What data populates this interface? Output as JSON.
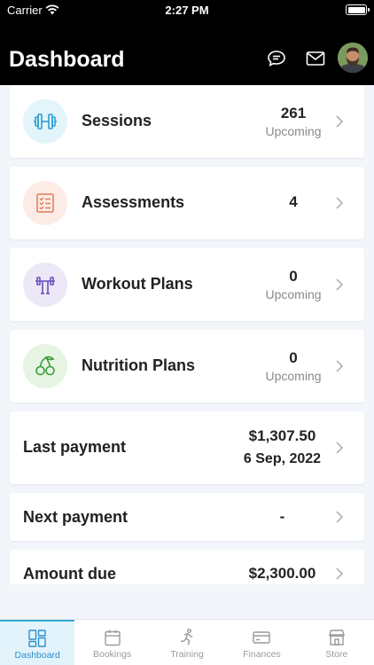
{
  "status_bar": {
    "carrier": "Carrier",
    "time": "2:27 PM"
  },
  "header": {
    "title": "Dashboard"
  },
  "cards": [
    {
      "label": "Sessions",
      "value": "261",
      "sub": "Upcoming",
      "icon": "dumbbell-icon",
      "icon_bg": "#e3f4fa",
      "icon_color": "#2a9fd0"
    },
    {
      "label": "Assessments",
      "value": "4",
      "sub": "",
      "icon": "checklist-icon",
      "icon_bg": "#fdece6",
      "icon_color": "#e07a5a"
    },
    {
      "label": "Workout Plans",
      "value": "0",
      "sub": "Upcoming",
      "icon": "barbell-icon",
      "icon_bg": "#ece8f8",
      "icon_color": "#6a4fc0"
    },
    {
      "label": "Nutrition Plans",
      "value": "0",
      "sub": "Upcoming",
      "icon": "cherries-icon",
      "icon_bg": "#e6f4e3",
      "icon_color": "#3c9a3c"
    }
  ],
  "payments": {
    "last": {
      "label": "Last payment",
      "amount": "$1,307.50",
      "date": "6 Sep, 2022"
    },
    "next": {
      "label": "Next payment",
      "amount": "-"
    },
    "due": {
      "label": "Amount due",
      "amount": "$2,300.00"
    }
  },
  "tabs": [
    {
      "label": "Dashboard",
      "icon": "dashboard-icon",
      "active": true
    },
    {
      "label": "Bookings",
      "icon": "calendar-icon",
      "active": false
    },
    {
      "label": "Training",
      "icon": "runner-icon",
      "active": false
    },
    {
      "label": "Finances",
      "icon": "card-icon",
      "active": false
    },
    {
      "label": "Store",
      "icon": "store-icon",
      "active": false
    }
  ],
  "colors": {
    "accent": "#33a8d8",
    "header_bg": "#000000",
    "page_bg": "#f2f5fa"
  }
}
